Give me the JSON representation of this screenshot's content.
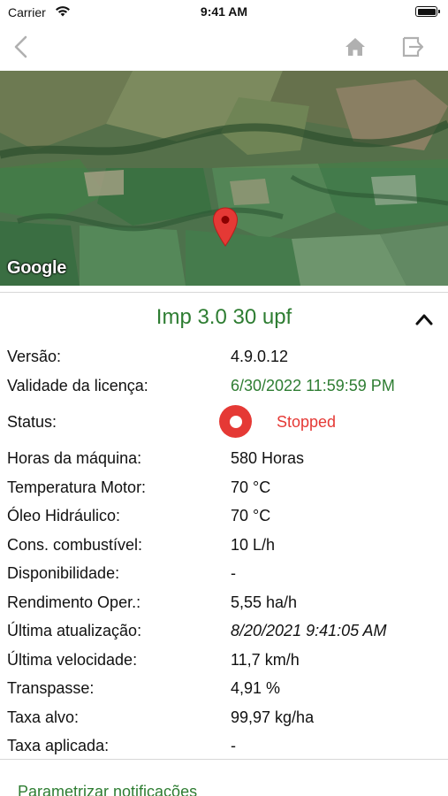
{
  "status_bar": {
    "carrier": "Carrier",
    "time": "9:41 AM",
    "battery_level": 1.0
  },
  "navbar": {
    "back_icon": "chevron-left-icon",
    "home_icon": "home-icon",
    "logout_icon": "logout-icon",
    "icon_color": "#b0b0b0"
  },
  "map": {
    "attribution": "Google",
    "pin_color": "#e53935"
  },
  "device": {
    "title": "Imp 3.0 30 upf",
    "collapse_icon": "chevron-up-icon"
  },
  "details": {
    "version": {
      "label": "Versão:",
      "value": "4.9.0.12"
    },
    "license": {
      "label": "Validade da licença:",
      "value": "6/30/2022 11:59:59 PM"
    },
    "status": {
      "label": "Status:",
      "value": "Stopped",
      "icon": "stop-record-icon",
      "color": "#e53935"
    },
    "machine_hours": {
      "label": "Horas da máquina:",
      "value": "580 Horas"
    },
    "engine_temp": {
      "label": "Temperatura Motor:",
      "value": "70 °C"
    },
    "hydraulic_oil": {
      "label": "Óleo Hidráulico:",
      "value": "70 °C"
    },
    "fuel": {
      "label": "Cons. combustível:",
      "value": "10 L/h"
    },
    "availability": {
      "label": "Disponibilidade:",
      "value": "-"
    },
    "yield": {
      "label": "Rendimento Oper.:",
      "value": "5,55 ha/h"
    },
    "last_update": {
      "label": "Última atualização:",
      "value": "8/20/2021 9:41:05 AM"
    },
    "last_speed": {
      "label": "Última velocidade:",
      "value": "11,7 km/h"
    },
    "overlap": {
      "label": "Transpasse:",
      "value": "4,91 %"
    },
    "target_rate": {
      "label": "Taxa alvo:",
      "value": "99,97 kg/ha"
    },
    "applied_rate": {
      "label": "Taxa aplicada:",
      "value": "-"
    }
  },
  "actions": {
    "notifications_link": "Parametrizar notificações"
  },
  "colors": {
    "accent_green": "#2e7d32",
    "status_red": "#e53935"
  }
}
